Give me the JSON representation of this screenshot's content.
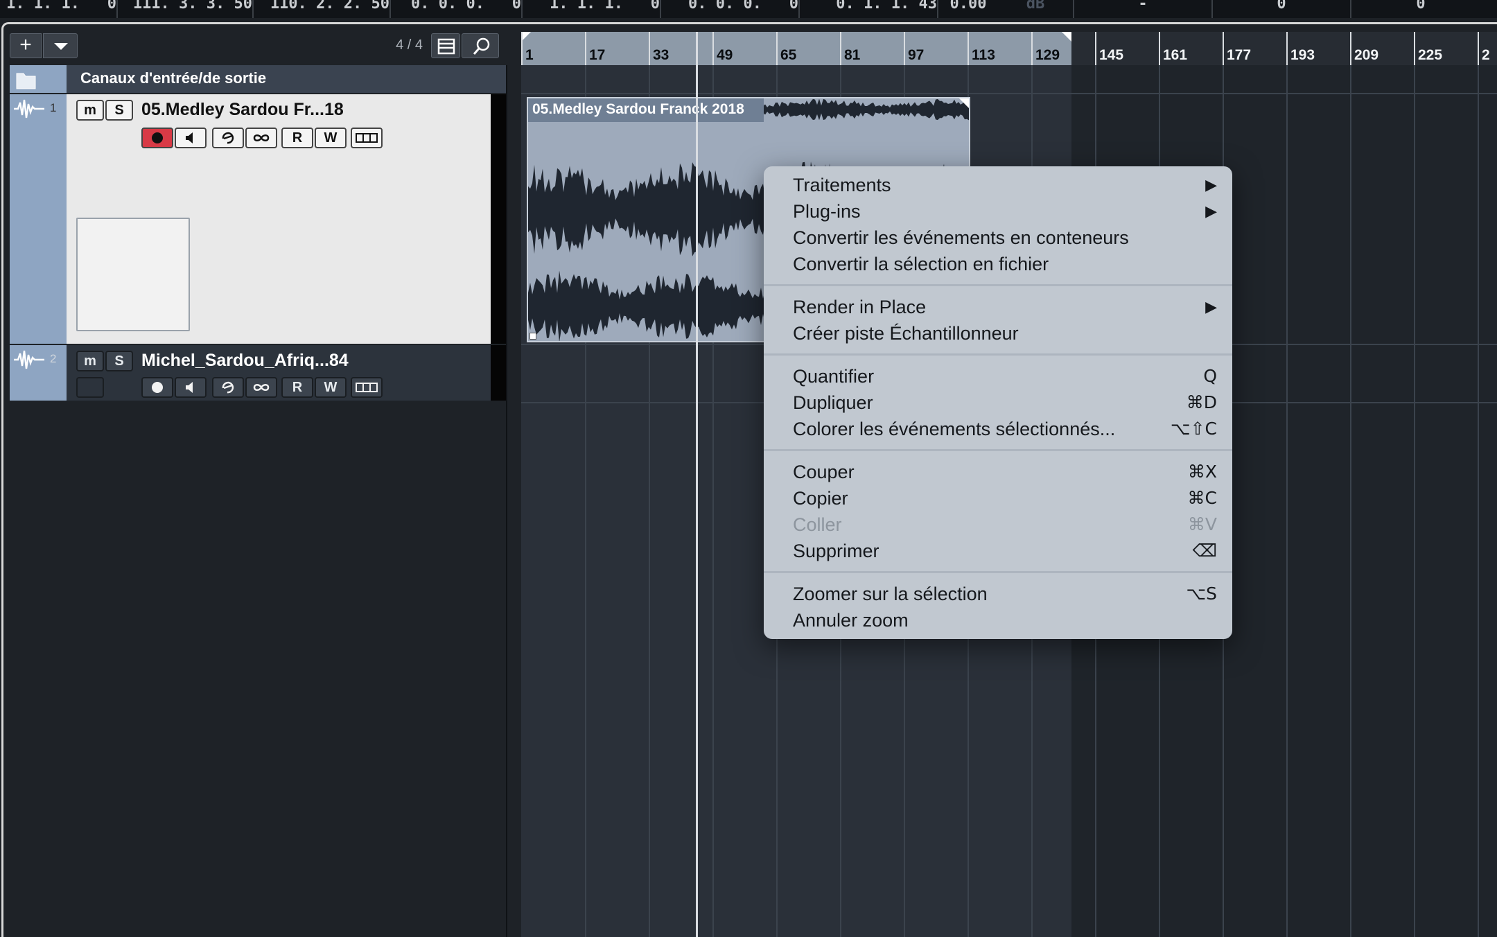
{
  "transport": {
    "cells": [
      {
        "text": "1. 1. 1.   0"
      },
      {
        "text": "111. 3. 3. 50"
      },
      {
        "text": "110. 2. 2. 50"
      },
      {
        "text": "0. 0. 0.   0"
      },
      {
        "text": "1. 1. 1.   0"
      },
      {
        "text": "0. 0. 0.   0"
      },
      {
        "text": "0. 1. 1. 43"
      },
      {
        "text": "0.00"
      },
      {
        "text": "dB"
      },
      {
        "text": "-"
      },
      {
        "text": "0"
      },
      {
        "text": "0"
      }
    ]
  },
  "toolbar": {
    "add_label": "+",
    "time_signature": "4 / 4"
  },
  "track_list": {
    "io_label": "Canaux d'entrée/de sortie",
    "tracks": [
      {
        "number": "1",
        "name": "05.Medley Sardou Fr...18",
        "m": "m",
        "s": "S",
        "r": "R",
        "w": "W"
      },
      {
        "number": "2",
        "name": "Michel_Sardou_Afriq...84",
        "m": "m",
        "s": "S",
        "r": "R",
        "w": "W"
      }
    ]
  },
  "ruler": {
    "bars": [
      "1",
      "17",
      "33",
      "49",
      "65",
      "81",
      "97",
      "113",
      "129",
      "145",
      "161",
      "177",
      "193",
      "209",
      "225",
      "2"
    ]
  },
  "event": {
    "name": "05.Medley Sardou Franck 2018"
  },
  "context_menu": {
    "items": [
      {
        "label": "Traitements",
        "shortcut": "",
        "submenu": true
      },
      {
        "label": "Plug-ins",
        "shortcut": "",
        "submenu": true
      },
      {
        "label": "Convertir les événements en conteneurs",
        "shortcut": ""
      },
      {
        "label": "Convertir la sélection en fichier",
        "shortcut": ""
      },
      {
        "label": "Render in Place",
        "shortcut": "",
        "submenu": true
      },
      {
        "label": "Créer piste Échantillonneur",
        "shortcut": ""
      },
      {
        "label": "Quantifier",
        "shortcut": "Q"
      },
      {
        "label": "Dupliquer",
        "shortcut": "⌘D"
      },
      {
        "label": "Colorer les événements sélectionnés...",
        "shortcut": "⌥⇧C"
      },
      {
        "label": "Couper",
        "shortcut": "⌘X"
      },
      {
        "label": "Copier",
        "shortcut": "⌘C"
      },
      {
        "label": "Coller",
        "shortcut": "⌘V",
        "disabled": true
      },
      {
        "label": "Supprimer",
        "shortcut": "⌫"
      },
      {
        "label": "Zoomer sur la sélection",
        "shortcut": "⌥S"
      },
      {
        "label": "Annuler zoom",
        "shortcut": ""
      }
    ]
  },
  "colors": {
    "track_side": "#8ea5c2",
    "record_active": "#d83a46",
    "event_body": "#9eaabb",
    "menu_bg": "#c1c8d0"
  }
}
